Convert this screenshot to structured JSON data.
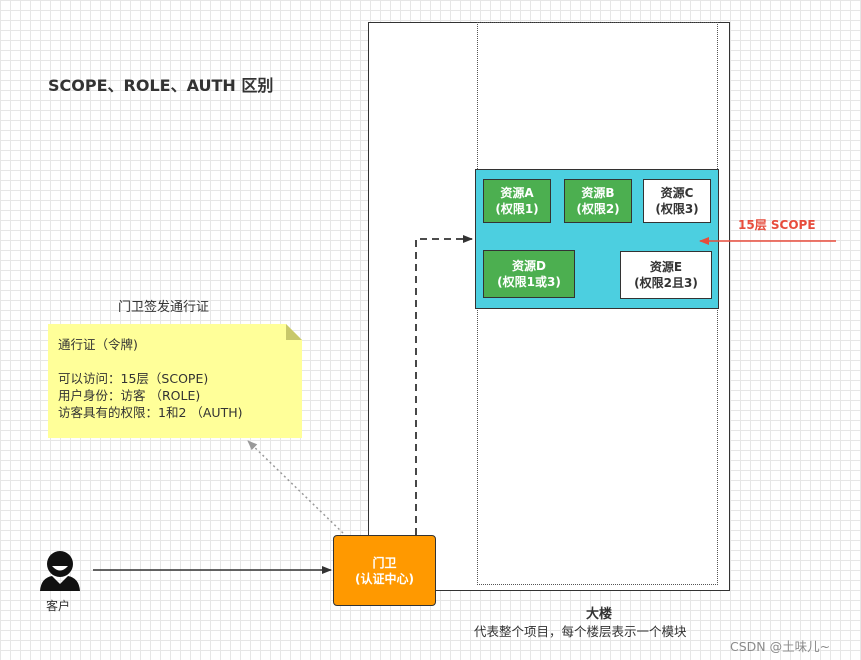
{
  "title": "SCOPE、ROLE、AUTH 区别",
  "building": {
    "title": "大楼",
    "description": "代表整个项目，每个楼层表示一个模块"
  },
  "scope": {
    "label": "15层 SCOPE",
    "resources": {
      "a": {
        "name": "资源A",
        "perm": "(权限1)"
      },
      "b": {
        "name": "资源B",
        "perm": "(权限2)"
      },
      "c": {
        "name": "资源C",
        "perm": "(权限3)"
      },
      "d": {
        "name": "资源D",
        "perm": "(权限1或3)"
      },
      "e": {
        "name": "资源E",
        "perm": "(权限2且3)"
      }
    }
  },
  "note": {
    "caption": "门卫签发通行证",
    "line1": "通行证（令牌)",
    "line2": "可以访问：15层（SCOPE)",
    "line3": "用户身份：访客 （ROLE)",
    "line4": "访客具有的权限：1和2 （AUTH)"
  },
  "gate": {
    "name": "门卫",
    "sub": "(认证中心)"
  },
  "client": {
    "label": "客户"
  },
  "watermark": "CSDN @土味儿~",
  "colors": {
    "scope_fill": "#4ccfe0",
    "granted_resource": "#4caf50",
    "gate": "#ff9900",
    "note": "#ffff99",
    "scope_label": "#e74c3c"
  }
}
